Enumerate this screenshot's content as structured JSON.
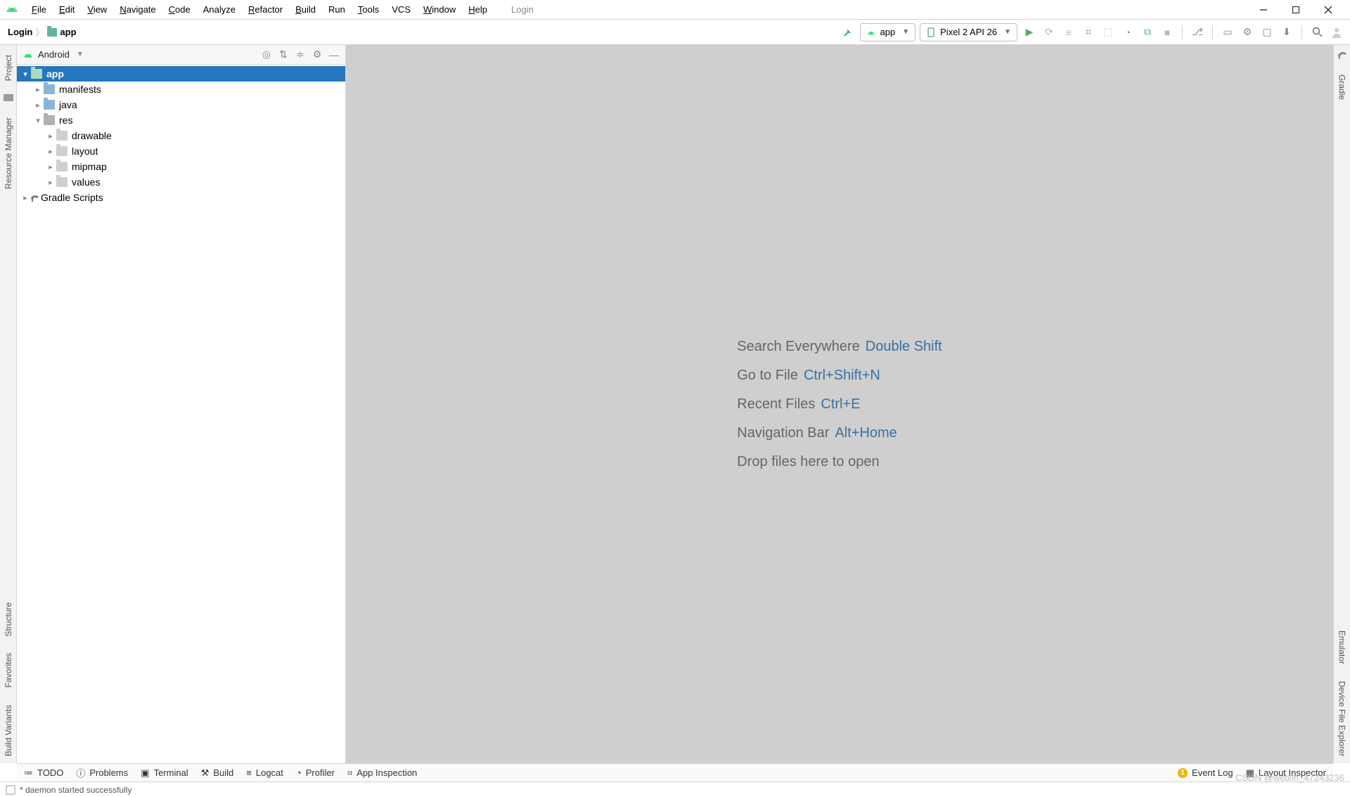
{
  "window_title": "Login",
  "menu": {
    "file": "File",
    "edit": "Edit",
    "view": "View",
    "navigate": "Navigate",
    "code": "Code",
    "analyze": "Analyze",
    "refactor": "Refactor",
    "build": "Build",
    "run": "Run",
    "tools": "Tools",
    "vcs": "VCS",
    "window": "Window",
    "help": "Help"
  },
  "breadcrumb": {
    "root": "Login",
    "leaf": "app"
  },
  "run_config": {
    "module": "app",
    "device": "Pixel 2 API 26"
  },
  "project_view": {
    "label": "Android"
  },
  "tree": {
    "app": "app",
    "manifests": "manifests",
    "java": "java",
    "res": "res",
    "drawable": "drawable",
    "layout": "layout",
    "mipmap": "mipmap",
    "values": "values",
    "gradle": "Gradle Scripts"
  },
  "tips": [
    {
      "label": "Search Everywhere",
      "shortcut": "Double Shift"
    },
    {
      "label": "Go to File",
      "shortcut": "Ctrl+Shift+N"
    },
    {
      "label": "Recent Files",
      "shortcut": "Ctrl+E"
    },
    {
      "label": "Navigation Bar",
      "shortcut": "Alt+Home"
    }
  ],
  "tips_drop": "Drop files here to open",
  "left_strip": {
    "project": "Project",
    "resmgr": "Resource Manager",
    "structure": "Structure",
    "favorites": "Favorites",
    "variants": "Build Variants"
  },
  "right_strip": {
    "gradle": "Gradle",
    "emulator": "Emulator",
    "devfile": "Device File Explorer"
  },
  "bottom_tabs": {
    "todo": "TODO",
    "problems": "Problems",
    "terminal": "Terminal",
    "build": "Build",
    "logcat": "Logcat",
    "profiler": "Profiler",
    "appinsp": "App Inspection",
    "eventlog": "Event Log",
    "layoutinsp": "Layout Inspector"
  },
  "status": "* daemon started successfully",
  "watermark": "CSDN @weixin_47243236"
}
